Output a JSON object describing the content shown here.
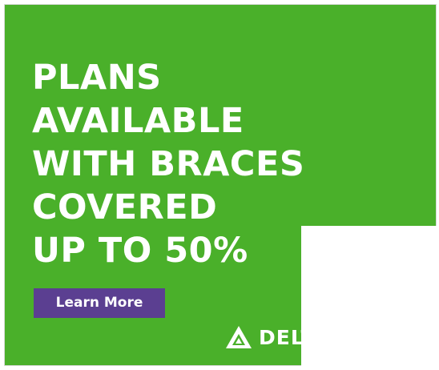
{
  "ad": {
    "headline_lines": [
      "PLANS",
      "AVAILABLE",
      "WITH BRACES",
      "COVERED",
      "UP TO 50%"
    ],
    "cta_label": "Learn More",
    "logo_text": "DELT",
    "logo_icon": "delta-triangle-icon",
    "colors": {
      "background": "#4ab02a",
      "cta": "#5b3f91",
      "text": "#ffffff"
    }
  }
}
